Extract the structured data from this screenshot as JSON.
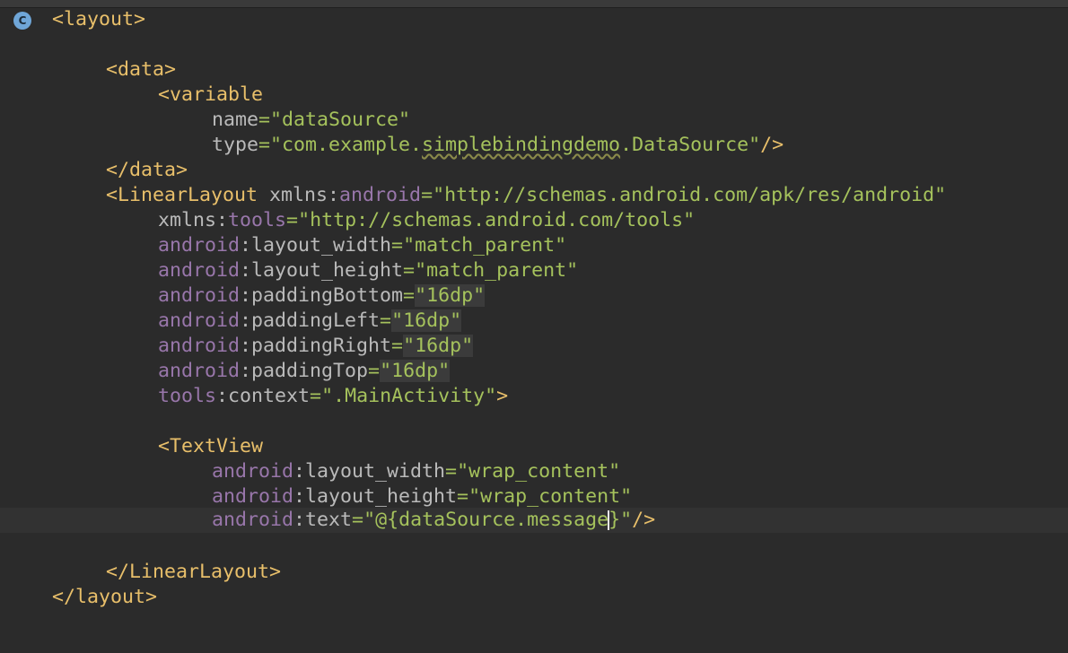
{
  "editor": {
    "gutter_badge": "C",
    "lines": {
      "l1": {
        "tag": "<layout>"
      },
      "l3": {
        "tag": "<data>"
      },
      "l4": {
        "tag": "<variable"
      },
      "l5": {
        "attr": "name",
        "eq": "=",
        "val": "\"dataSource\""
      },
      "l6": {
        "attr": "type",
        "eq": "=",
        "val_pre": "\"com.example.",
        "val_typo": "simplebindingdemo",
        "val_post": ".DataSource\"",
        "close": "/>"
      },
      "l7": {
        "tag": "</data>"
      },
      "l8": {
        "tag": "<LinearLayout",
        "attr": " xmlns",
        "colon": ":",
        "ns": "android",
        "eq": "=",
        "val": "\"http://schemas.android.com/apk/res/android\""
      },
      "l9": {
        "attr": "xmlns",
        "colon": ":",
        "ns": "tools",
        "eq": "=",
        "val": "\"http://schemas.android.com/tools\""
      },
      "l10": {
        "ns": "android",
        "colon": ":",
        "attr": "layout_width",
        "eq": "=",
        "val": "\"match_parent\""
      },
      "l11": {
        "ns": "android",
        "colon": ":",
        "attr": "layout_height",
        "eq": "=",
        "val": "\"match_parent\""
      },
      "l12": {
        "ns": "android",
        "colon": ":",
        "attr": "paddingBottom",
        "eq": "=",
        "val": "\"16dp\""
      },
      "l13": {
        "ns": "android",
        "colon": ":",
        "attr": "paddingLeft",
        "eq": "=",
        "val": "\"16dp\""
      },
      "l14": {
        "ns": "android",
        "colon": ":",
        "attr": "paddingRight",
        "eq": "=",
        "val": "\"16dp\""
      },
      "l15": {
        "ns": "android",
        "colon": ":",
        "attr": "paddingTop",
        "eq": "=",
        "val": "\"16dp\""
      },
      "l16": {
        "ns": "tools",
        "colon": ":",
        "attr": "context",
        "eq": "=",
        "val": "\".MainActivity\"",
        "close": ">"
      },
      "l18": {
        "tag": "<TextView"
      },
      "l19": {
        "ns": "android",
        "colon": ":",
        "attr": "layout_width",
        "eq": "=",
        "val": "\"wrap_content\""
      },
      "l20": {
        "ns": "android",
        "colon": ":",
        "attr": "layout_height",
        "eq": "=",
        "val": "\"wrap_content\""
      },
      "l21": {
        "ns": "android",
        "colon": ":",
        "attr": "text",
        "eq": "=",
        "val_pre": "\"@{dataSource.message",
        "val_post": "}\"",
        "close": "/>"
      },
      "l23": {
        "tag": "</LinearLayout>"
      },
      "l24": {
        "tag": "</layout>"
      }
    }
  }
}
